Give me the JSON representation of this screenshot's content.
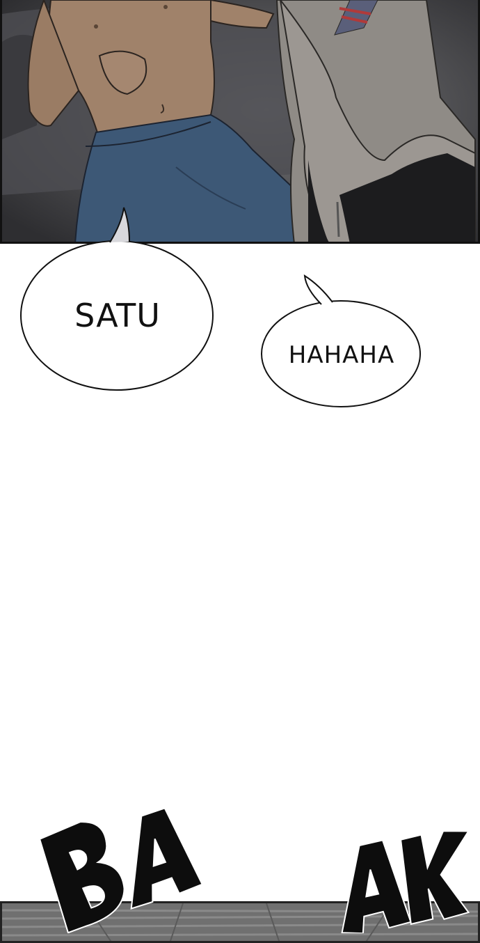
{
  "dialogue": {
    "bubble_1": "SATU",
    "bubble_2": "HAHAHA"
  },
  "sound_effect": {
    "part_1": "BA",
    "part_2": "AK"
  }
}
